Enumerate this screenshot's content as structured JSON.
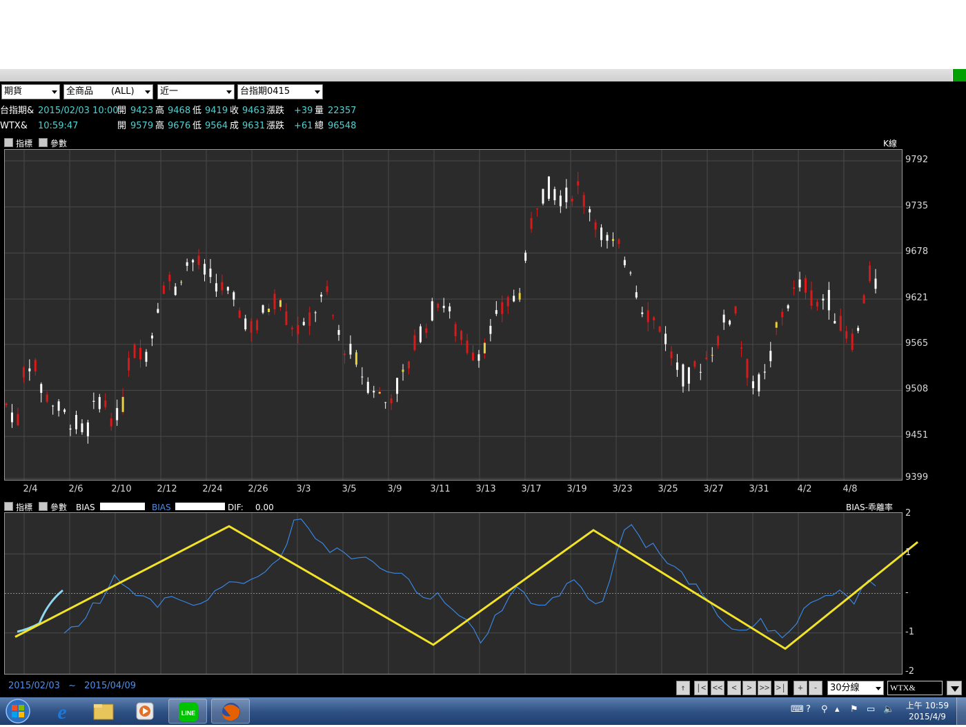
{
  "toolbar": {
    "market": "期貨",
    "category": "全商品　　(ALL)",
    "contract_month": "近一",
    "symbol": "台指期0415"
  },
  "quote_rows": [
    {
      "name": "台指期&",
      "time": "2015/02/03 10:00",
      "open_label": "開",
      "open": "9423",
      "high_label": "高",
      "high": "9468",
      "low_label": "低",
      "low": "9419",
      "last_label": "收",
      "last": "9463",
      "chg_label": "漲跌",
      "chg": "+39",
      "vol_label": "量",
      "vol": "22357"
    },
    {
      "name": "WTX&",
      "time": "10:59:47",
      "open_label": "開",
      "open": "9579",
      "high_label": "高",
      "high": "9676",
      "low_label": "低",
      "low": "9564",
      "last_label": "成",
      "last": "9631",
      "chg_label": "漲跌",
      "chg": "+61",
      "vol_label": "總",
      "vol": "96548"
    }
  ],
  "main_panel": {
    "indicator_label": "指標",
    "param_label": "參數",
    "chart_name": "K線"
  },
  "sub_panel": {
    "indicator_label": "指標",
    "param_label": "參數",
    "bias_label_1": "BIAS",
    "bias_label_2": "BIAS",
    "dif_label": "DIF:",
    "dif_value": "0.00",
    "chart_name": "BIAS-乖離率"
  },
  "chart_data": [
    {
      "type": "candlestick",
      "y_ticks": [
        "9792",
        "9735",
        "9678",
        "9621",
        "9565",
        "9508",
        "9451",
        "9399"
      ],
      "x_ticks": [
        "2/4",
        "2/6",
        "2/10",
        "2/12",
        "2/24",
        "2/26",
        "3/3",
        "3/5",
        "3/9",
        "3/11",
        "3/13",
        "3/17",
        "3/19",
        "3/23",
        "3/25",
        "3/27",
        "3/31",
        "4/2",
        "4/8"
      ],
      "ylim": [
        9399,
        9792
      ],
      "grid": true,
      "close_trend": [
        9490,
        9480,
        9470,
        9540,
        9545,
        9530,
        9505,
        9500,
        9490,
        9480,
        9475,
        9470,
        9460,
        9455,
        9470,
        9500,
        9495,
        9480,
        9470,
        9480,
        9540,
        9555,
        9560,
        9555,
        9580,
        9620,
        9640,
        9645,
        9630,
        9660,
        9665,
        9670,
        9660,
        9650,
        9645,
        9640,
        9630,
        9620,
        9610,
        9600,
        9590,
        9580,
        9600,
        9610,
        9620,
        9625,
        9600,
        9590,
        9585,
        9580,
        9600,
        9610,
        9620,
        9625,
        9590,
        9570,
        9560,
        9550,
        9540,
        9520,
        9515,
        9510,
        9490,
        9500,
        9510,
        9520,
        9535,
        9560,
        9580,
        9590,
        9605,
        9620,
        9615,
        9600,
        9580,
        9570,
        9560,
        9555,
        9560,
        9570,
        9585,
        9600,
        9610,
        9620,
        9625,
        9640,
        9700,
        9740,
        9750,
        9760,
        9755,
        9750,
        9745,
        9755,
        9760,
        9745,
        9735,
        9720,
        9700,
        9690,
        9685,
        9680,
        9670,
        9660,
        9620,
        9610,
        9600,
        9590,
        9585,
        9560,
        9540,
        9530,
        9520,
        9530,
        9540,
        9545,
        9560,
        9570,
        9590,
        9600,
        9610,
        9560,
        9530,
        9520,
        9515,
        9525,
        9560,
        9590,
        9610,
        9625,
        9630,
        9640,
        9635,
        9610,
        9620,
        9625,
        9610,
        9590,
        9580,
        9570,
        9575,
        9620,
        9650,
        9640
      ],
      "candle_count": 150
    },
    {
      "type": "line",
      "series": [
        {
          "name": "BIAS",
          "values": [
            -0.95,
            -0.9,
            -0.8,
            -0.6,
            -0.3,
            -0.2,
            0.1,
            0.5,
            0.3,
            0.1,
            -0.05,
            -0.1,
            -0.2,
            -0.3,
            -0.15,
            -0.1,
            -0.2,
            -0.25,
            -0.3,
            -0.2,
            -0.1,
            0.0,
            0.15,
            0.3,
            0.25,
            0.2,
            0.35,
            0.45,
            0.55,
            0.7,
            0.9,
            1.3,
            1.8,
            1.9,
            1.7,
            1.4,
            1.2,
            1.05,
            1.1,
            1.0,
            0.9,
            0.85,
            0.95,
            0.8,
            0.7,
            0.6,
            0.5,
            0.45,
            0.3,
            0.1,
            -0.05,
            -0.1,
            0.0,
            -0.2,
            -0.4,
            -0.6,
            -0.7,
            -0.9,
            -1.2,
            -1.0,
            -0.6,
            -0.4,
            -0.1,
            0.1,
            0.0,
            -0.2,
            -0.3,
            -0.25,
            -0.1,
            0.0,
            0.3,
            0.4,
            0.2,
            -0.1,
            -0.3,
            -0.2,
            0.4,
            1.0,
            1.6,
            1.8,
            1.5,
            1.1,
            1.2,
            1.0,
            0.8,
            0.7,
            0.5,
            0.3,
            0.2,
            0.0,
            -0.3,
            -0.6,
            -0.8,
            -0.9,
            -1.0,
            -0.95,
            -0.8,
            -0.7,
            -0.9,
            -1.0,
            -1.1,
            -1.0,
            -0.7,
            -0.4,
            -0.2,
            -0.1,
            -0.05,
            0.0,
            0.05,
            -0.05,
            -0.2,
            0.1,
            0.4,
            0.2
          ]
        },
        {
          "name": "trend",
          "values": [
            -1.1,
            1.7,
            -1.3,
            1.6,
            -1.4,
            1.3
          ]
        }
      ],
      "y_ticks": [
        "2",
        "1",
        "-",
        "-1",
        "-2"
      ],
      "ylim": [
        -2,
        2
      ],
      "grid": true
    }
  ],
  "footer": {
    "date_from": "2015/02/03",
    "date_sep": "~",
    "date_to": "2015/04/09",
    "nav_buttons": [
      "↑",
      "|<",
      "<<",
      "<",
      ">",
      ">>",
      ">|",
      "+",
      "-"
    ],
    "period": "30分線",
    "symbol_input": "WTX&"
  },
  "taskbar": {
    "clock_time": "上午 10:59",
    "clock_date": "2015/4/9",
    "colors": {
      "ie": "#1e78d7",
      "firefox": "#e66000",
      "line": "#00c300"
    }
  }
}
